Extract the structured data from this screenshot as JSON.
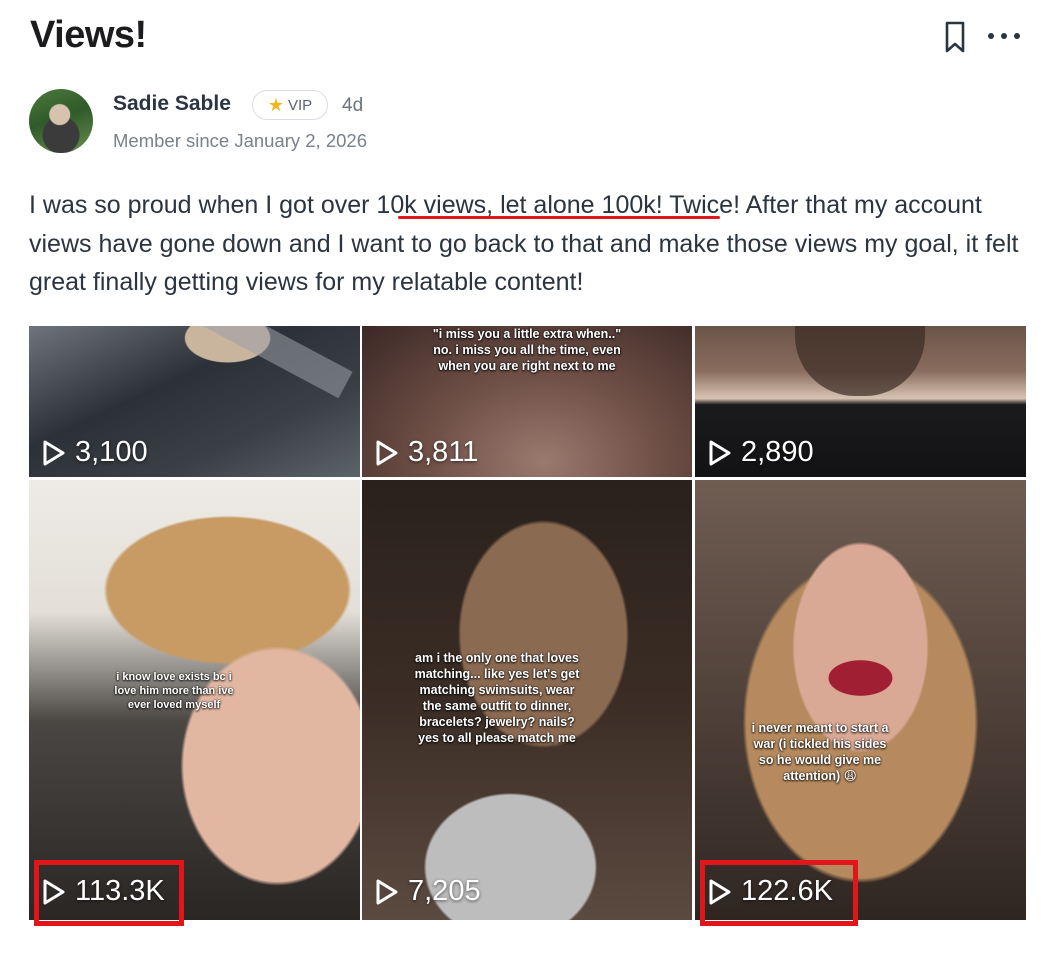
{
  "post": {
    "title": "Views!",
    "author": "Sadie Sable",
    "badge": "VIP",
    "age": "4d",
    "member_since": "Member since January 2, 2026",
    "body": "I was so proud when I got over 10k views, let alone 100k! Twice! After that my account views have gone down and I want to go back to that and make those views my goal, it felt great finally getting views for my relatable content!"
  },
  "icons": {
    "bookmark": "bookmark-icon",
    "more": "more-options-icon",
    "badge_star": "star-icon",
    "play": "play-icon"
  },
  "colors": {
    "highlight": "#e1161b",
    "text": "#2b3441",
    "muted": "#7a818c"
  },
  "videos": [
    {
      "views": "3,100",
      "caption": ""
    },
    {
      "views": "3,811",
      "caption": "\"i miss you a little extra when..\" no. i miss you all the time, even when you are right next to me"
    },
    {
      "views": "2,890",
      "caption": ""
    },
    {
      "views": "113.3K",
      "caption": "i know love exists bc i love him more than ive ever loved myself",
      "highlighted": true
    },
    {
      "views": "7,205",
      "caption": "am i the only one that loves matching... like yes let's get matching swimsuits, wear the same outfit to dinner, bracelets? jewelry? nails? yes to all please match me"
    },
    {
      "views": "122.6K",
      "caption": "i never meant to start a war (i tickled his sides so he would give me attention) 😩",
      "highlighted": true
    }
  ]
}
